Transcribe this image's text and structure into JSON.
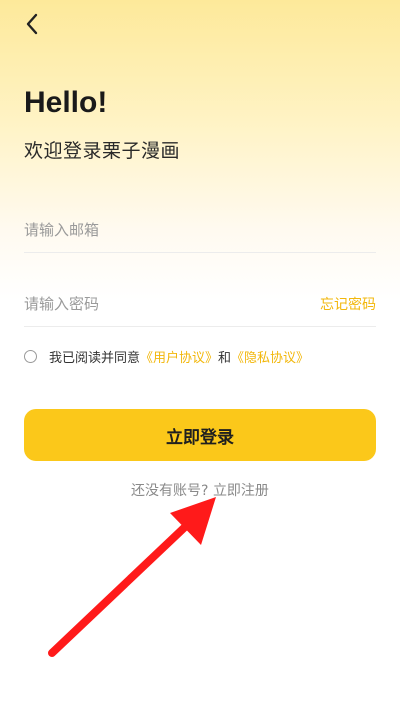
{
  "header": {
    "back_icon": "chevron-left-icon"
  },
  "hero": {
    "title": "Hello!",
    "subtitle": "欢迎登录栗子漫画"
  },
  "form": {
    "email_placeholder": "请输入邮箱",
    "email_value": "",
    "password_placeholder": "请输入密码",
    "password_value": "",
    "forgot_password": "忘记密码"
  },
  "agreement": {
    "checked": false,
    "prefix": "我已阅读并同意",
    "user_agreement": "《用户协议》",
    "conjunction": "和",
    "privacy_policy": "《隐私协议》"
  },
  "login_button": "立即登录",
  "register": {
    "prompt": "还没有账号?",
    "link": "立即注册"
  },
  "annotation": {
    "arrow_color": "#ff1a1a"
  },
  "colors": {
    "accent": "#fbc81a",
    "link": "#f2b70b",
    "bg_top": "#fde99a"
  }
}
